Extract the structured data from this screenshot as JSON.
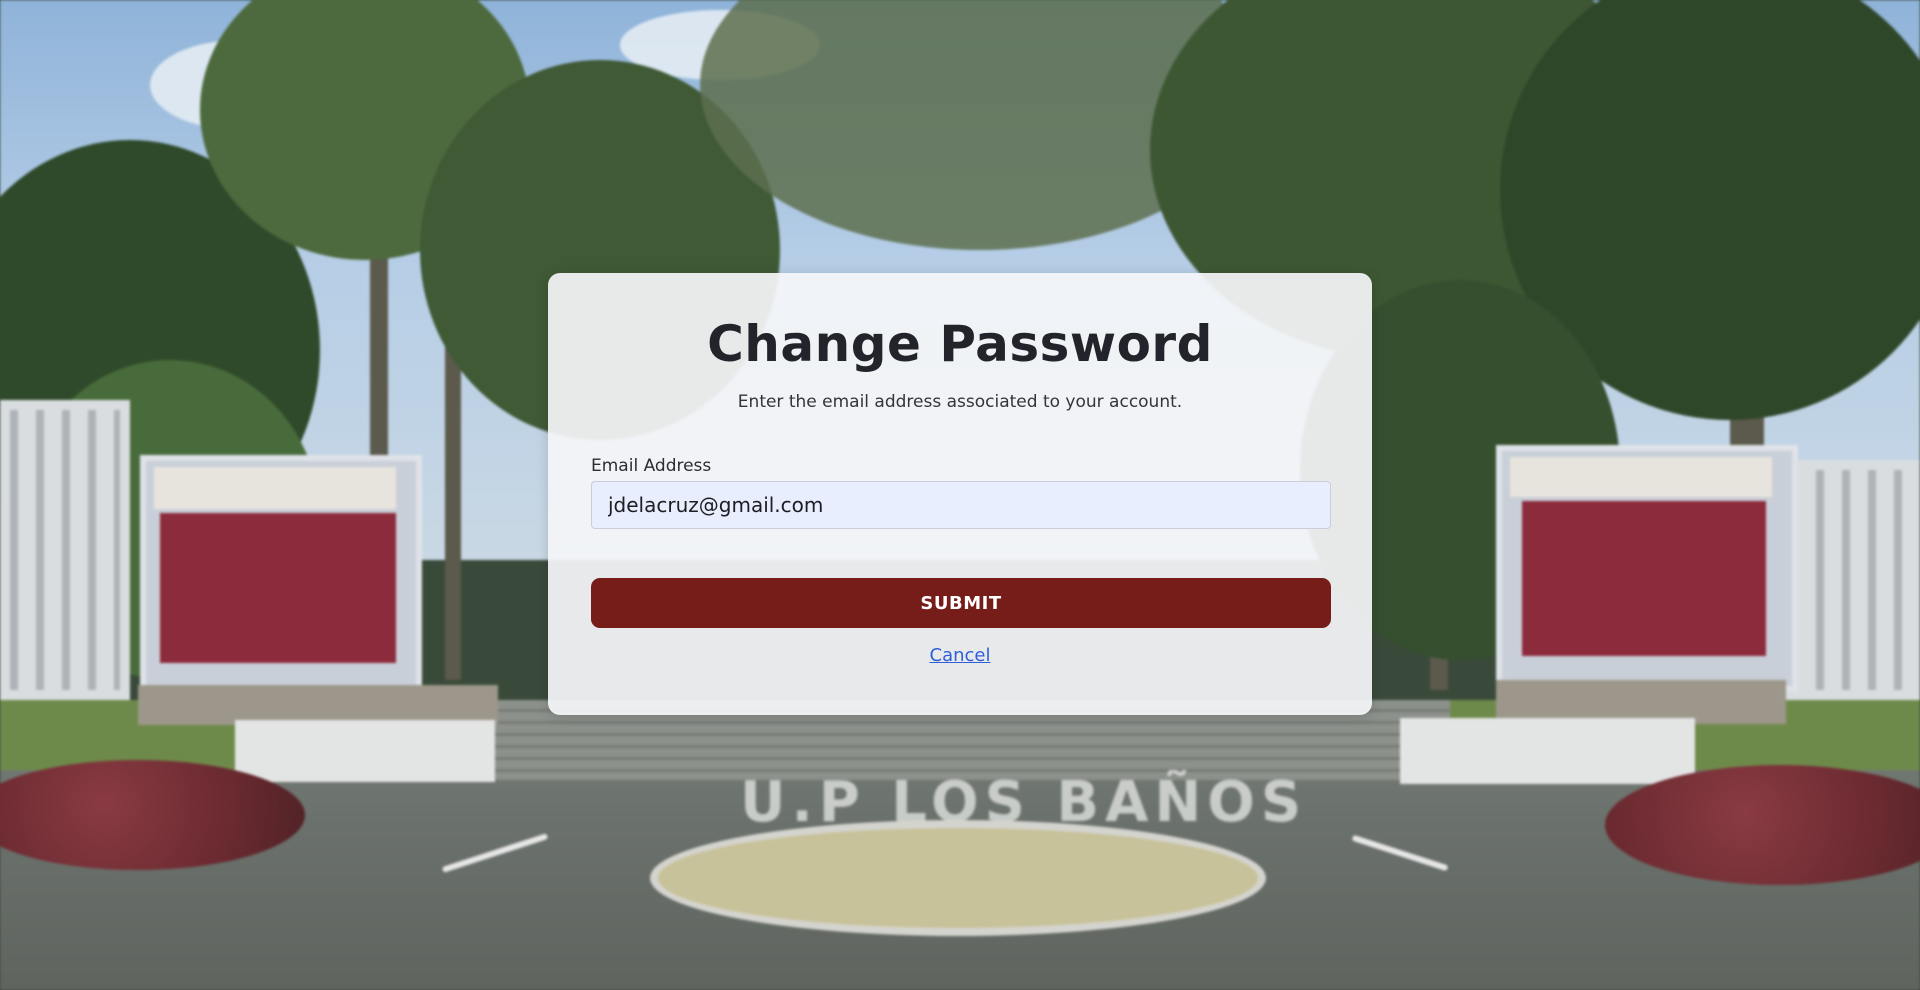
{
  "dialog": {
    "title": "Change Password",
    "subtitle": "Enter the email address associated to your account.",
    "email_label": "Email Address",
    "email_value": "jdelacruz@gmail.com",
    "submit_label": "SUBMIT",
    "cancel_label": "Cancel"
  },
  "background": {
    "sign_text": "U.P LOS BAÑOS"
  },
  "colors": {
    "submit_button": "#761c19",
    "link": "#2f5fd8",
    "input_background": "#e8eefe",
    "card_background": "#f4f5f7"
  }
}
